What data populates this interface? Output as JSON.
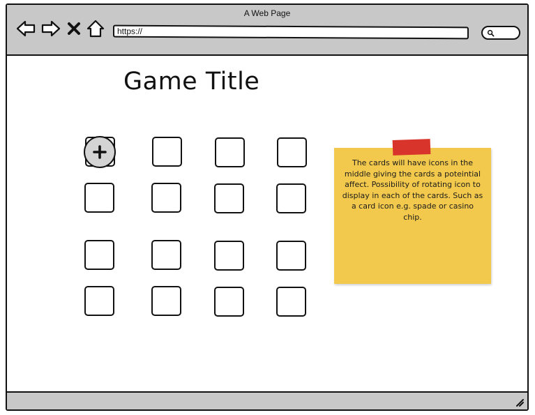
{
  "window": {
    "title": "A Web Page"
  },
  "browser": {
    "url": "https://",
    "nav": [
      "back-icon",
      "forward-icon",
      "close-icon",
      "home-icon"
    ],
    "search_icon": "search-icon"
  },
  "page": {
    "title": "Game Title",
    "card_grid": {
      "rows": 4,
      "columns": 4,
      "selected_card_icon": "plus-icon"
    },
    "note": {
      "text": "The cards will have icons in the middle giving the cards a poteintial affect. Possibility of rotating icon to display in each of the cards. Such as a card icon e.g. spade or casino chip.",
      "color": "#f2c94c",
      "tape_color": "#d9342b"
    }
  },
  "colors": {
    "chrome": "#c8c8c8",
    "outline": "#111111"
  }
}
